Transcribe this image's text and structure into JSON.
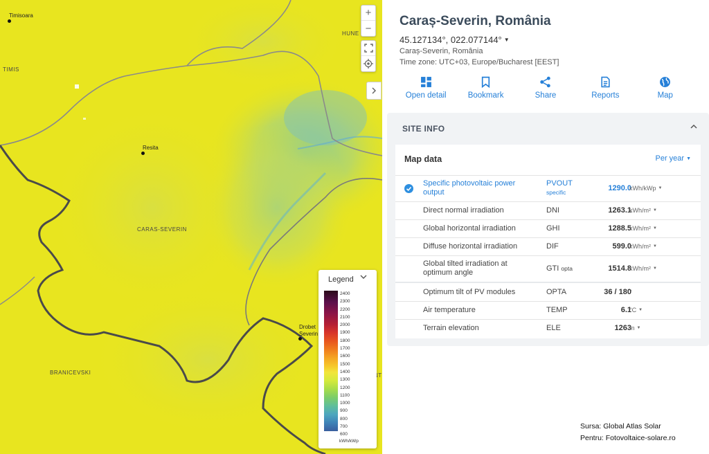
{
  "map": {
    "labels": {
      "timis": "TIMIS",
      "caras_severin": "CARAS-SEVERIN",
      "branicevski": "BRANICEVSKI",
      "hune": "HUNE",
      "nt": "NT"
    },
    "cities": {
      "timisoara": "Timisoara",
      "resita": "Resita",
      "drobeta_line1": "Drobet",
      "drobeta_line2": "Severin"
    },
    "controls": {
      "zoom_in": "+",
      "zoom_out": "−",
      "fullscreen_icon": "fullscreen-icon",
      "locate_icon": "locate-icon",
      "collapse_icon": "chevron-right-icon"
    },
    "legend": {
      "title": "Legend",
      "ticks": [
        "2400",
        "2300",
        "2200",
        "2100",
        "2000",
        "1900",
        "1800",
        "1700",
        "1600",
        "1500",
        "1400",
        "1300",
        "1200",
        "1100",
        "1000",
        "900",
        "800",
        "700",
        "600"
      ],
      "unit": "kWh/kWp"
    },
    "colors": {
      "base": "#e8e51f",
      "border_dark": "#4a4a4a",
      "border_grey": "#8a8a8a"
    }
  },
  "panel": {
    "title": "Caraș-Severin, România",
    "coords": "45.127134°, 022.077144°",
    "region": "Caraș-Severin, România",
    "timezone": "Time zone: UTC+03, Europe/Bucharest [EEST]",
    "actions": [
      {
        "label": "Open detail",
        "icon": "grid-icon"
      },
      {
        "label": "Bookmark",
        "icon": "bookmark-icon"
      },
      {
        "label": "Share",
        "icon": "share-icon"
      },
      {
        "label": "Reports",
        "icon": "document-icon"
      },
      {
        "label": "Map",
        "icon": "globe-icon"
      }
    ],
    "site_info": {
      "header": "SITE INFO",
      "map_data_title": "Map data",
      "period": "Per year",
      "rows": [
        {
          "name": "Specific photovoltaic power output",
          "abbr": "PVOUT",
          "abbr_sub": "specific",
          "value": "1290.0",
          "unit": "kWh/kWp",
          "selected": true
        },
        {
          "name": "Direct normal irradiation",
          "abbr": "DNI",
          "abbr_sub": "",
          "value": "1263.1",
          "unit": "kWh/m²"
        },
        {
          "name": "Global horizontal irradiation",
          "abbr": "GHI",
          "abbr_sub": "",
          "value": "1288.5",
          "unit": "kWh/m²"
        },
        {
          "name": "Diffuse horizontal irradiation",
          "abbr": "DIF",
          "abbr_sub": "",
          "value": "599.0",
          "unit": "kWh/m²"
        },
        {
          "name": "Global tilted irradiation at optimum angle",
          "abbr": "GTI",
          "abbr_sub": "opta",
          "value": "1514.8",
          "unit": "kWh/m²"
        },
        {
          "name": "Optimum tilt of PV modules",
          "abbr": "OPTA",
          "abbr_sub": "",
          "value": "36 /  180",
          "unit": "°"
        },
        {
          "name": "Air temperature",
          "abbr": "TEMP",
          "abbr_sub": "",
          "value": "6.1",
          "unit": "°C"
        },
        {
          "name": "Terrain elevation",
          "abbr": "ELE",
          "abbr_sub": "",
          "value": "1263",
          "unit": "m"
        }
      ]
    }
  },
  "source": {
    "line1": "Sursa: Global Atlas Solar",
    "line2": "Pentru: Fotovoltaice-solare.ro"
  },
  "accent_color": "#2680d8"
}
